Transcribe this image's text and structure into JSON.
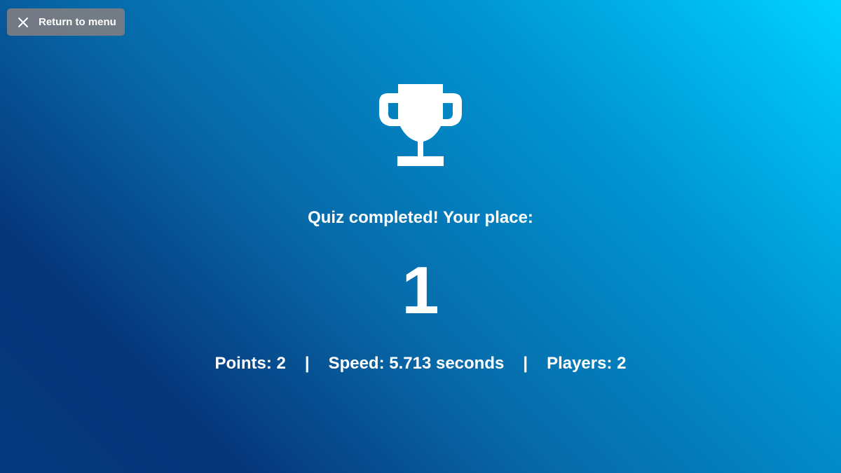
{
  "header": {
    "return_label": "Return to menu",
    "return_icon": "close-icon"
  },
  "result": {
    "icon": "trophy-icon",
    "headline": "Quiz completed! Your place:",
    "place": "1"
  },
  "stats": {
    "points": "Points: 2",
    "speed": "Speed: 5.713 seconds",
    "players": "Players: 2",
    "separator": "|"
  },
  "colors": {
    "gradient_light": "#00d2ff",
    "gradient_dark": "#063a7e",
    "button_bg": "#7d7d82",
    "text": "#ffffff"
  }
}
